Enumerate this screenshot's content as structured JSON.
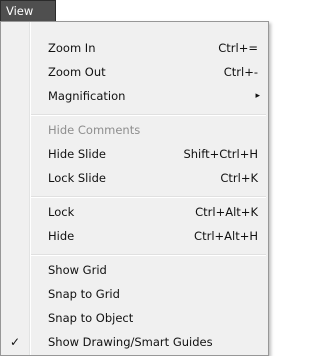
{
  "menubar": {
    "view_label": "View"
  },
  "menu": {
    "items": [
      {
        "label": "Zoom In",
        "shortcut": "Ctrl+="
      },
      {
        "label": "Zoom Out",
        "shortcut": "Ctrl+-"
      },
      {
        "label": "Magnification",
        "shortcut": "▸"
      },
      {
        "label": "Hide Comments",
        "shortcut": "",
        "disabled": true
      },
      {
        "label": "Hide Slide",
        "shortcut": "Shift+Ctrl+H"
      },
      {
        "label": "Lock Slide",
        "shortcut": "Ctrl+K"
      },
      {
        "label": "Lock",
        "shortcut": "Ctrl+Alt+K"
      },
      {
        "label": "Hide",
        "shortcut": "Ctrl+Alt+H"
      },
      {
        "label": "Show Grid",
        "shortcut": ""
      },
      {
        "label": "Snap to Grid",
        "shortcut": ""
      },
      {
        "label": "Snap to Object",
        "shortcut": ""
      },
      {
        "label": "Show Drawing/Smart Guides",
        "shortcut": "",
        "checked": true,
        "check_glyph": "✓"
      }
    ]
  },
  "icons": {
    "submenu": "chevron-right-icon",
    "check": "checkmark-icon"
  },
  "colors": {
    "menubar_active_bg": "#4f4f4f",
    "menu_bg": "#f0f0f0",
    "disabled_text": "#8e8e8e"
  }
}
